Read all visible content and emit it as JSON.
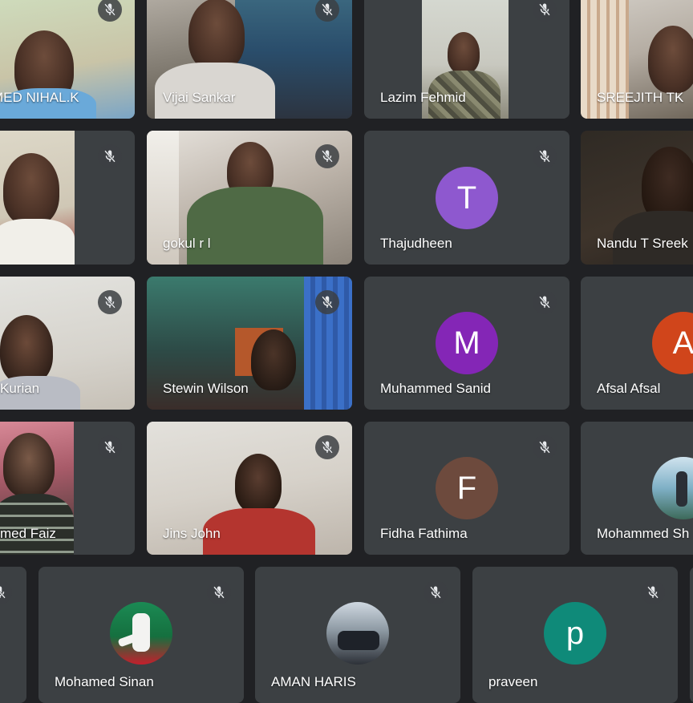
{
  "participants": [
    {
      "name": "MED NIHAL.K"
    },
    {
      "name": "Vijai Sankar"
    },
    {
      "name": "Lazim Fehmid"
    },
    {
      "name": "SREEJITH TK"
    },
    {
      "name": ""
    },
    {
      "name": "gokul r l"
    },
    {
      "name": "Thajudheen",
      "initial": "T",
      "color": "#8e58cf"
    },
    {
      "name": "Nandu T Sreek"
    },
    {
      "name": "Kurian"
    },
    {
      "name": "Stewin Wilson"
    },
    {
      "name": "Muhammed Sanid",
      "initial": "M",
      "color": "#8426b6"
    },
    {
      "name": "Afsal Afsal",
      "initial": "A",
      "color": "#d0451b"
    },
    {
      "name": "med Faiz"
    },
    {
      "name": "Jins John"
    },
    {
      "name": "Fidha Fathima",
      "initial": "F",
      "color": "#6d4a3d"
    },
    {
      "name": "Mohammed Sh"
    },
    {
      "name": ""
    },
    {
      "name": "Mohamed Sinan"
    },
    {
      "name": "AMAN HARIS"
    },
    {
      "name": "praveen",
      "initial": "p",
      "color": "#0f8a79"
    }
  ],
  "icons": {
    "mute": "mic-off-icon"
  },
  "colors": {
    "background": "#202124",
    "tile": "#3c4043"
  }
}
